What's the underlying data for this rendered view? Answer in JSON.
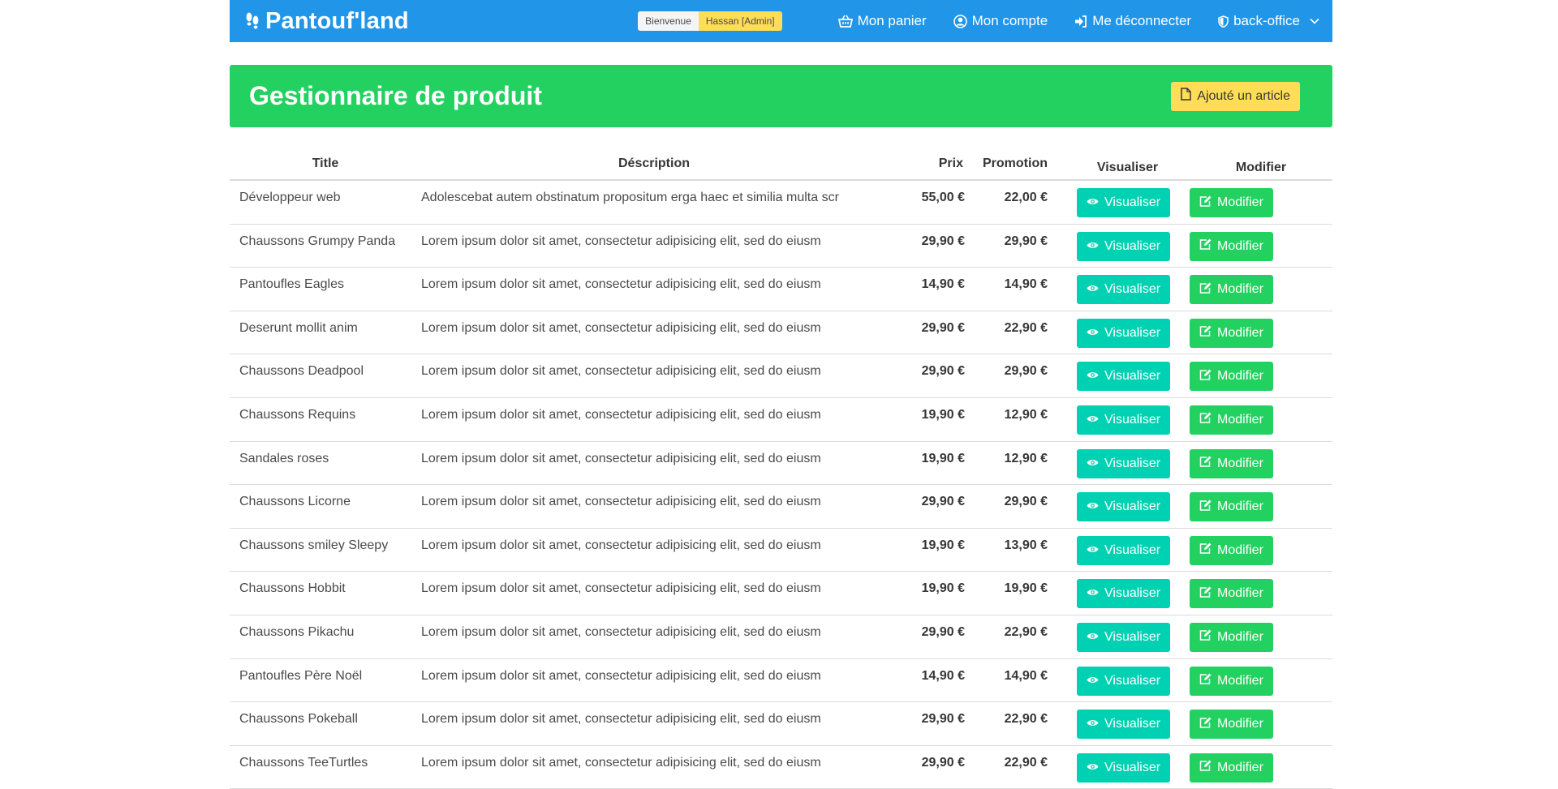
{
  "navbar": {
    "brand": "Pantouf'land",
    "welcome": "Bienvenue",
    "user": "Hassan [Admin]",
    "cart": "Mon panier",
    "account": "Mon compte",
    "logout": "Me déconnecter",
    "backoffice": "back-office"
  },
  "hero": {
    "title": "Gestionnaire de produit",
    "add_label": "Ajouté un article"
  },
  "table": {
    "headers": {
      "title": "Title",
      "desc": "Déscription",
      "prix": "Prix",
      "promo": "Promotion",
      "vis": "Visualiser",
      "mod": "Modifier"
    },
    "view_label": "Visualiser",
    "edit_label": "Modifier",
    "rows": [
      {
        "title": "Développeur web",
        "desc": "Adolescebat autem obstinatum propositum erga haec et similia multa scr",
        "prix": "55,00 €",
        "promo": "22,00 €"
      },
      {
        "title": "Chaussons Grumpy Panda",
        "desc": "Lorem ipsum dolor sit amet, consectetur adipisicing elit, sed do eiusm",
        "prix": "29,90 €",
        "promo": "29,90 €"
      },
      {
        "title": "Pantoufles Eagles",
        "desc": "Lorem ipsum dolor sit amet, consectetur adipisicing elit, sed do eiusm",
        "prix": "14,90 €",
        "promo": "14,90 €"
      },
      {
        "title": "Deserunt mollit anim",
        "desc": "Lorem ipsum dolor sit amet, consectetur adipisicing elit, sed do eiusm",
        "prix": "29,90 €",
        "promo": "22,90 €"
      },
      {
        "title": "Chaussons Deadpool",
        "desc": "Lorem ipsum dolor sit amet, consectetur adipisicing elit, sed do eiusm",
        "prix": "29,90 €",
        "promo": "29,90 €"
      },
      {
        "title": "Chaussons Requins",
        "desc": "Lorem ipsum dolor sit amet, consectetur adipisicing elit, sed do eiusm",
        "prix": "19,90 €",
        "promo": "12,90 €"
      },
      {
        "title": "Sandales roses",
        "desc": "Lorem ipsum dolor sit amet, consectetur adipisicing elit, sed do eiusm",
        "prix": "19,90 €",
        "promo": "12,90 €"
      },
      {
        "title": "Chaussons Licorne",
        "desc": "Lorem ipsum dolor sit amet, consectetur adipisicing elit, sed do eiusm",
        "prix": "29,90 €",
        "promo": "29,90 €"
      },
      {
        "title": "Chaussons smiley Sleepy",
        "desc": "Lorem ipsum dolor sit amet, consectetur adipisicing elit, sed do eiusm",
        "prix": "19,90 €",
        "promo": "13,90 €"
      },
      {
        "title": "Chaussons Hobbit",
        "desc": "Lorem ipsum dolor sit amet, consectetur adipisicing elit, sed do eiusm",
        "prix": "19,90 €",
        "promo": "19,90 €"
      },
      {
        "title": "Chaussons Pikachu",
        "desc": "Lorem ipsum dolor sit amet, consectetur adipisicing elit, sed do eiusm",
        "prix": "29,90 €",
        "promo": "22,90 €"
      },
      {
        "title": "Pantoufles Père Noël",
        "desc": "Lorem ipsum dolor sit amet, consectetur adipisicing elit, sed do eiusm",
        "prix": "14,90 €",
        "promo": "14,90 €"
      },
      {
        "title": "Chaussons Pokeball",
        "desc": "Lorem ipsum dolor sit amet, consectetur adipisicing elit, sed do eiusm",
        "prix": "29,90 €",
        "promo": "22,90 €"
      },
      {
        "title": "Chaussons TeeTurtles",
        "desc": "Lorem ipsum dolor sit amet, consectetur adipisicing elit, sed do eiusm",
        "prix": "29,90 €",
        "promo": "22,90 €"
      }
    ]
  },
  "colors": {
    "navbar": "#2196e9",
    "hero": "#23d160",
    "warning": "#ffdd57",
    "primary": "#00d1b2",
    "success": "#23d160"
  },
  "icons": [
    "footprints-icon",
    "basket-icon",
    "user-circle-icon",
    "sign-out-icon",
    "shield-icon",
    "chevron-down-icon",
    "file-icon",
    "eye-icon",
    "edit-icon"
  ]
}
